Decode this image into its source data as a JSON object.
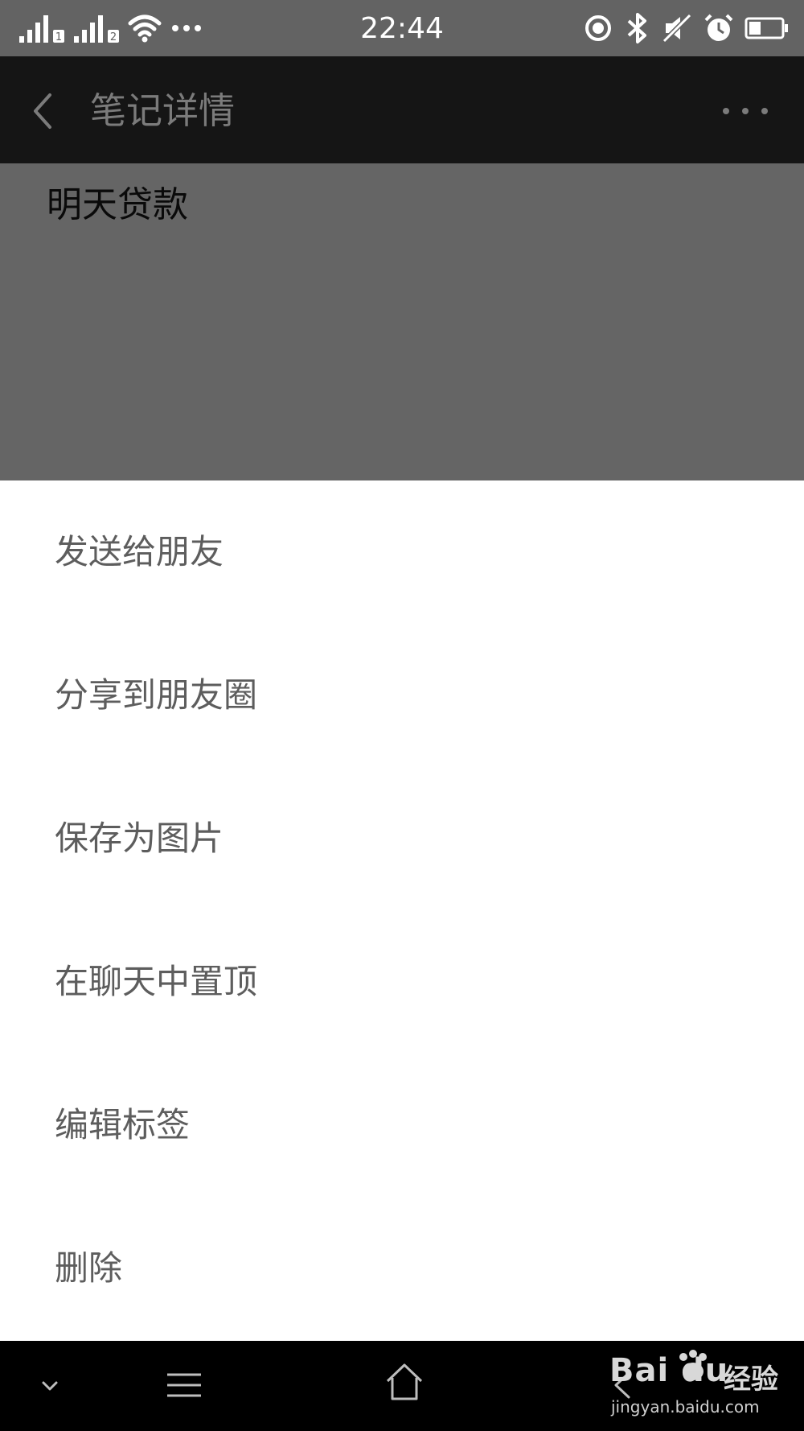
{
  "status_bar": {
    "time": "22:44",
    "sim1_label": "1",
    "sim2_label": "2"
  },
  "nav": {
    "title": "笔记详情"
  },
  "note": {
    "content": "明天贷款"
  },
  "menu": {
    "items": [
      {
        "label": "发送给朋友"
      },
      {
        "label": "分享到朋友圈"
      },
      {
        "label": "保存为图片"
      },
      {
        "label": "在聊天中置顶"
      },
      {
        "label": "编辑标签"
      },
      {
        "label": "删除"
      }
    ]
  },
  "watermark": {
    "brand": "Bai du",
    "cn": "经验",
    "url": "jingyan.baidu.com"
  },
  "colors": {
    "nav_bg": "#151515",
    "status_bg": "#636363",
    "dim_bg": "#656565",
    "menu_text": "#5d5d5d"
  }
}
